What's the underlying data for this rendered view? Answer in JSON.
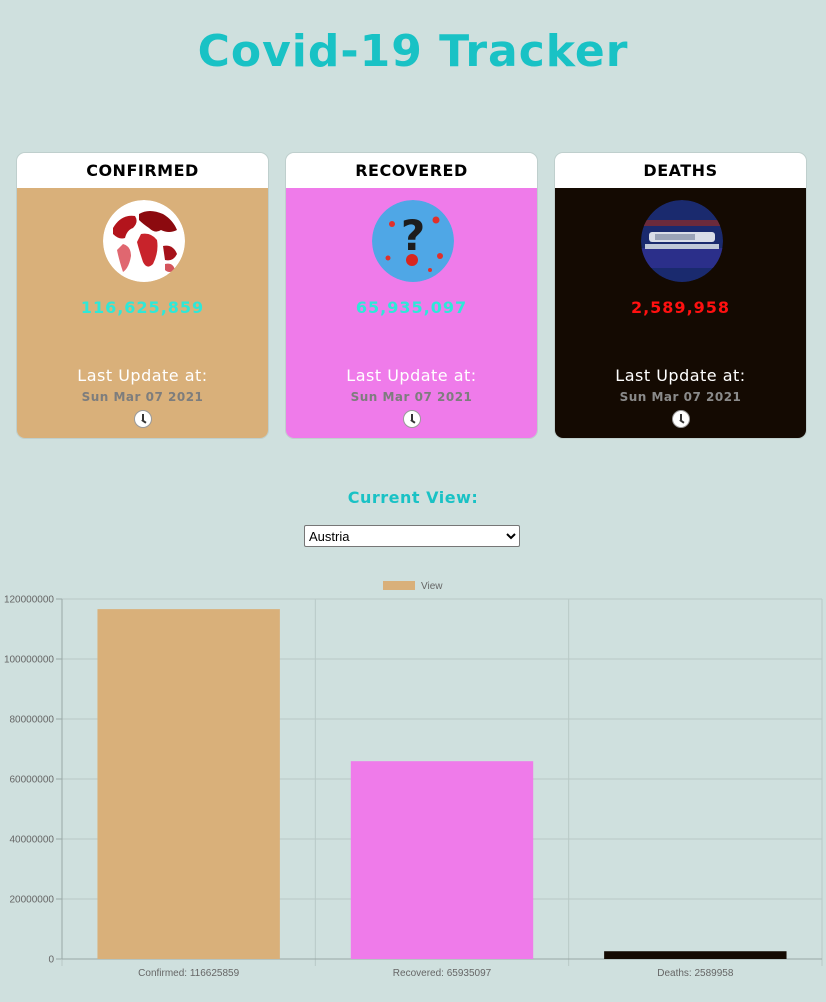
{
  "page": {
    "title": "Covid-19 Tracker"
  },
  "cards": [
    {
      "heading": "CONFIRMED",
      "count": "116,625,859",
      "update_label": "Last Update at:",
      "date": "Sun Mar 07 2021",
      "bg": "#d9b07a",
      "count_color": "#2ee8d8",
      "image": "world-map-image"
    },
    {
      "heading": "RECOVERED",
      "count": "65,935,097",
      "update_label": "Last Update at:",
      "date": "Sun Mar 07 2021",
      "bg": "#ef7bea",
      "count_color": "#2ee8d8",
      "image": "virus-question-image"
    },
    {
      "heading": "DEATHS",
      "count": "2,589,958",
      "update_label": "Last Update at:",
      "date": "Sun Mar 07 2021",
      "bg": "#140a02",
      "count_color": "#ff1010",
      "image": "test-tube-image"
    }
  ],
  "current_view": {
    "label": "Current View:",
    "selected": "Austria",
    "options": [
      "Austria"
    ]
  },
  "chart_data": {
    "type": "bar",
    "legend": {
      "label": "View",
      "placement": "top"
    },
    "categories": [
      "Confirmed: 116625859",
      "Recovered: 65935097",
      "Deaths: 2589958"
    ],
    "values": [
      116625859,
      65935097,
      2589958
    ],
    "colors": [
      "#d9b07a",
      "#ef7bea",
      "#140a02"
    ],
    "ylim": [
      0,
      120000000
    ],
    "yticks": [
      0,
      20000000,
      40000000,
      60000000,
      80000000,
      100000000,
      120000000
    ],
    "grid": true
  }
}
